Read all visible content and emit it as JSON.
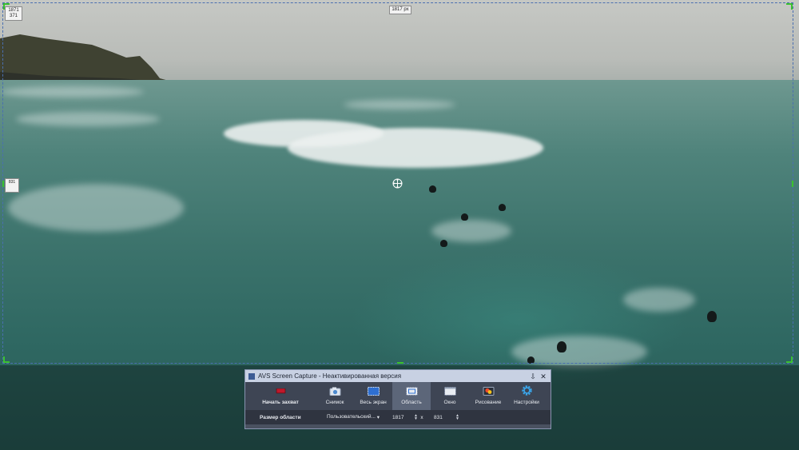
{
  "capture_overlay": {
    "top_left_coords": [
      "1871",
      "371"
    ],
    "width_label": "1817 px",
    "height_label": "831"
  },
  "toolbar": {
    "title": "AVS Screen Capture - Неактивированная версия",
    "buttons": {
      "start_capture": "Начать захват",
      "snapshot": "Снимок",
      "fullscreen": "Весь экран",
      "region": "Область",
      "window": "Окно",
      "drawing": "Рисование",
      "settings": "Настройки"
    },
    "size_row": {
      "label": "Размер области",
      "preset": "Пользовательский...",
      "width": "1817",
      "x": "x",
      "height": "831"
    },
    "colors": {
      "titlebar": "#c8d1e3",
      "body": "#3e4554",
      "active_tool": "#5c6679",
      "record": "#c0182a"
    },
    "icons": [
      "minimize-icon",
      "close-icon",
      "record-icon",
      "camera-icon",
      "fullscreen-icon",
      "region-icon",
      "window-icon",
      "drawing-icon",
      "gear-icon"
    ]
  },
  "region_frame": {
    "border_color": "#4a6fb0",
    "handle_color": "#3bc12f"
  }
}
